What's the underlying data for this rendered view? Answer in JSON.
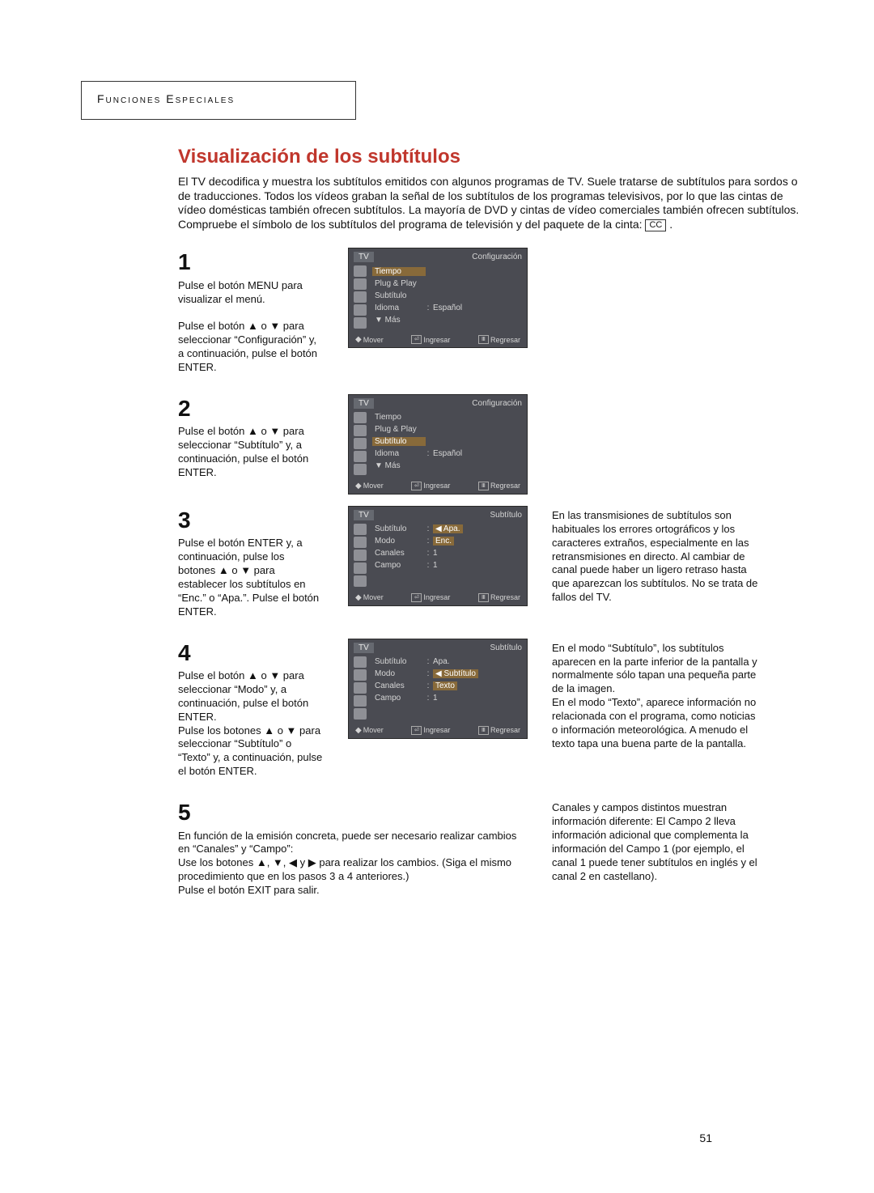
{
  "header": "Funciones Especiales",
  "title": "Visualización de los subtítulos",
  "intro": "El TV decodifica y muestra los subtítulos emitidos con algunos programas de TV. Suele tratarse de subtítulos para sordos o de traducciones. Todos los vídeos graban la señal de los subtítulos de los programas televisivos, por lo que las cintas de vídeo domésticas también ofrecen subtítulos. La mayoría de DVD y cintas de vídeo comerciales también ofrecen subtítulos. Compruebe el símbolo de los subtítulos del programa de televisión y del paquete de la cinta:",
  "cc_symbol": "CC",
  "steps": {
    "s1": {
      "num": "1",
      "text": "Pulse el botón MENU para visualizar el menú.\n\nPulse el botón ▲ o ▼ para seleccionar “Configuración” y, a continuación, pulse el botón ENTER."
    },
    "s2": {
      "num": "2",
      "text": "Pulse el botón ▲ o ▼ para seleccionar “Subtítulo” y, a continuación, pulse el botón ENTER."
    },
    "s3": {
      "num": "3",
      "text": "Pulse el botón ENTER y, a continuación, pulse los botones ▲ o ▼ para establecer los subtítulos en “Enc.” o “Apa.”. Pulse el botón ENTER."
    },
    "s4": {
      "num": "4",
      "text": "Pulse el botón ▲ o ▼ para seleccionar “Modo” y, a continuación, pulse el botón ENTER.\nPulse los botones ▲ o ▼ para seleccionar “Subtítulo” o “Texto” y, a continuación, pulse el botón ENTER."
    },
    "s5": {
      "num": "5",
      "text": "En función de la emisión concreta, puede ser necesario realizar cambios en “Canales” y “Campo”:\nUse los botones ▲, ▼, ◀ y ▶ para realizar los cambios. (Siga el mismo procedimiento que en los pasos 3 a 4 anteriores.)\nPulse el botón EXIT para salir."
    }
  },
  "osd_common": {
    "tv": "TV",
    "footer": {
      "mover": "Mover",
      "ingresar": "Ingresar",
      "regresar": "Regresar"
    }
  },
  "osd1": {
    "title_right": "Configuración",
    "rows": {
      "tiempo": {
        "label": "Tiempo"
      },
      "plugplay": {
        "label": "Plug & Play"
      },
      "subtitulo": {
        "label": "Subtítulo"
      },
      "idioma": {
        "label": "Idioma",
        "val": "Español"
      },
      "mas": {
        "label": "▼ Más"
      }
    }
  },
  "osd2": {
    "title_right": "Configuración",
    "rows": {
      "tiempo": {
        "label": "Tiempo"
      },
      "plugplay": {
        "label": "Plug & Play"
      },
      "subtitulo": {
        "label": "Subtítulo"
      },
      "idioma": {
        "label": "Idioma",
        "val": "Español"
      },
      "mas": {
        "label": "▼ Más"
      }
    }
  },
  "osd3": {
    "title_right": "Subtítulo",
    "rows": {
      "subtitulo": {
        "label": "Subtítulo",
        "val_top": "◀ Apa.",
        "val_bot": "Enc."
      },
      "modo": {
        "label": "Modo"
      },
      "canales": {
        "label": "Canales",
        "val": "1"
      },
      "campo": {
        "label": "Campo",
        "val": "1"
      }
    }
  },
  "osd4": {
    "title_right": "Subtítulo",
    "rows": {
      "subtitulo": {
        "label": "Subtítulo",
        "val": "Apa."
      },
      "modo": {
        "label": "Modo",
        "val_top": "◀ Subtítulo",
        "val_bot": "Texto"
      },
      "canales": {
        "label": "Canales"
      },
      "campo": {
        "label": "Campo",
        "val": "1"
      }
    }
  },
  "right_notes": {
    "n1": "En las transmisiones de subtítulos son habituales los errores ortográficos y los caracteres extraños, especialmente en las retransmisiones en directo. Al cambiar de canal puede haber un ligero retraso hasta que aparezcan los subtítulos. No se trata de fallos del TV.",
    "n2": "En el modo “Subtítulo”, los subtítulos aparecen en la parte inferior de la pantalla y normalmente sólo tapan una pequeña parte de la imagen.\nEn el modo “Texto”, aparece información no relacionada con el programa, como noticias o información meteorológica. A menudo el texto tapa una buena parte de la pantalla.",
    "n3": "Canales y campos distintos muestran información diferente: El Campo 2 lleva información adicional que complementa la información del Campo 1 (por ejemplo, el canal 1 puede tener subtítulos en inglés y el canal 2 en castellano)."
  },
  "page_number": "51"
}
